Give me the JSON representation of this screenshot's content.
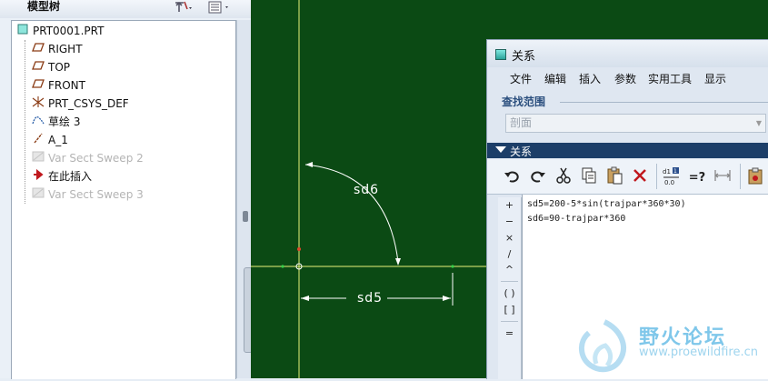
{
  "model_tree": {
    "title": "模型树",
    "settings_icon": "tree-settings-icon",
    "display_icon": "tree-display-icon",
    "root": "PRT0001.PRT",
    "items": [
      {
        "label": "RIGHT",
        "icon": "datum-plane-icon",
        "dim": false
      },
      {
        "label": "TOP",
        "icon": "datum-plane-icon",
        "dim": false
      },
      {
        "label": "FRONT",
        "icon": "datum-plane-icon",
        "dim": false
      },
      {
        "label": "PRT_CSYS_DEF",
        "icon": "csys-icon",
        "dim": false
      },
      {
        "label": "草绘 3",
        "icon": "sketch-icon",
        "dim": false
      },
      {
        "label": "A_1",
        "icon": "axis-icon",
        "dim": false
      },
      {
        "label": "Var Sect Sweep 2",
        "icon": "sweep-icon",
        "dim": true
      },
      {
        "label": "在此插入",
        "icon": "insert-here-arrow-icon",
        "dim": false
      },
      {
        "label": "Var Sect Sweep 3",
        "icon": "sweep-icon",
        "dim": true
      }
    ]
  },
  "graphics": {
    "dim_angle": "sd6",
    "dim_linear": "sd5",
    "background": "#0b4a14",
    "line_color": "#e9f27a"
  },
  "relations_dialog": {
    "title": "关系",
    "menu": [
      "文件",
      "编辑",
      "插入",
      "参数",
      "实用工具",
      "显示"
    ],
    "find_scope_label": "查找范围",
    "find_scope_value": "剖面",
    "section_label": "关系",
    "toolbar": [
      "undo-icon",
      "redo-icon",
      "cut-icon",
      "copy-icon",
      "paste-icon",
      "delete-icon",
      "evaluate-icon",
      "verify-icon",
      "units-icon",
      "sort-icon"
    ],
    "operators": [
      "+",
      "−",
      "×",
      "/",
      "^",
      "( )",
      "[ ]",
      "="
    ],
    "relations": [
      "sd5=200-5*sin(trajpar*360*30)",
      "sd6=90-trajpar*360"
    ]
  },
  "watermark": {
    "site_name": "野火论坛",
    "url": "www.proewildfire.cn"
  }
}
